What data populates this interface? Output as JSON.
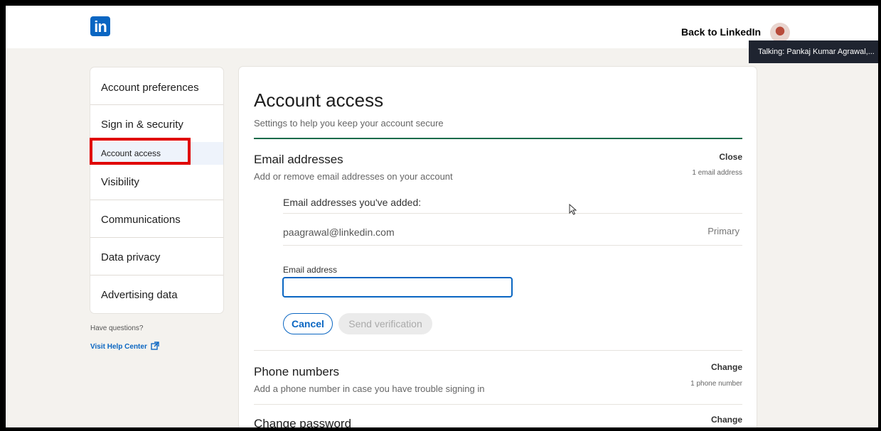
{
  "header": {
    "logo_text": "in",
    "back_link": "Back to LinkedIn",
    "talking_label": "Talking: Pankaj Kumar Agrawal,..."
  },
  "sidebar": {
    "items": [
      {
        "label": "Account preferences"
      },
      {
        "label": "Sign in & security"
      },
      {
        "label": "Account access",
        "active": true
      },
      {
        "label": "Visibility"
      },
      {
        "label": "Communications"
      },
      {
        "label": "Data privacy"
      },
      {
        "label": "Advertising data"
      }
    ],
    "help_question": "Have questions?",
    "help_link": "Visit Help Center"
  },
  "main": {
    "title": "Account access",
    "subtitle": "Settings to help you keep your account secure",
    "email_section": {
      "heading": "Email addresses",
      "description": "Add or remove email addresses on your account",
      "action": "Close",
      "count": "1 email address",
      "added_label": "Email addresses you've added:",
      "email": "paagrawal@linkedin.com",
      "email_status": "Primary",
      "field_label": "Email address",
      "field_value": "",
      "cancel_label": "Cancel",
      "send_label": "Send verification"
    },
    "phone_section": {
      "heading": "Phone numbers",
      "description": "Add a phone number in case you have trouble signing in",
      "action": "Change",
      "count": "1 phone number"
    },
    "password_section": {
      "heading": "Change password",
      "action": "Change"
    }
  },
  "colors": {
    "brand": "#0a66c2",
    "accent_line": "#1a6b4a",
    "highlight": "#e00000",
    "page_bg": "#f4f2ee"
  }
}
